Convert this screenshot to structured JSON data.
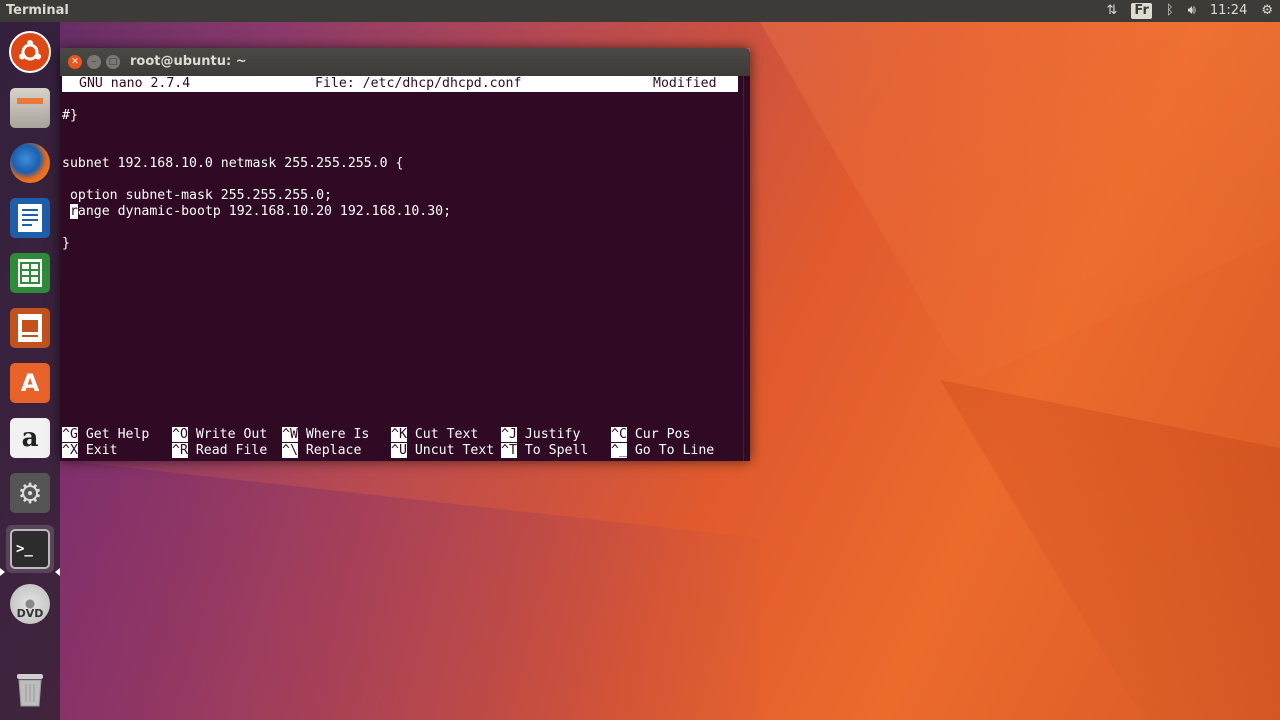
{
  "top_panel": {
    "title": "Terminal",
    "kbd_layout": "Fr",
    "clock": "11:24"
  },
  "launcher": {
    "items": [
      "ubuntu-dash",
      "files",
      "firefox",
      "libreoffice-writer",
      "libreoffice-calc",
      "libreoffice-impress",
      "ubuntu-software",
      "amazon",
      "system-settings",
      "terminal",
      "dvd",
      "trash"
    ]
  },
  "window": {
    "title": "root@ubuntu: ~"
  },
  "nano": {
    "app": "GNU nano 2.7.4",
    "file": "File: /etc/dhcp/dhcpd.conf",
    "status": "Modified",
    "lines": [
      "#}",
      "",
      "",
      "subnet 192.168.10.0 netmask 255.255.255.0 {",
      "",
      " option subnet-mask 255.255.255.0;",
      "ange dynamic-bootp 192.168.10.20 192.168.10.30;",
      "",
      "}"
    ],
    "cursor_char": "r",
    "shortcuts": [
      {
        "key": "^G",
        "label": "Get Help"
      },
      {
        "key": "^O",
        "label": "Write Out"
      },
      {
        "key": "^W",
        "label": "Where Is"
      },
      {
        "key": "^K",
        "label": "Cut Text"
      },
      {
        "key": "^J",
        "label": "Justify"
      },
      {
        "key": "^C",
        "label": "Cur Pos"
      },
      {
        "key": "^X",
        "label": "Exit"
      },
      {
        "key": "^R",
        "label": "Read File"
      },
      {
        "key": "^\\",
        "label": "Replace"
      },
      {
        "key": "^U",
        "label": "Uncut Text"
      },
      {
        "key": "^T",
        "label": "To Spell"
      },
      {
        "key": "^_",
        "label": "Go To Line"
      }
    ]
  }
}
